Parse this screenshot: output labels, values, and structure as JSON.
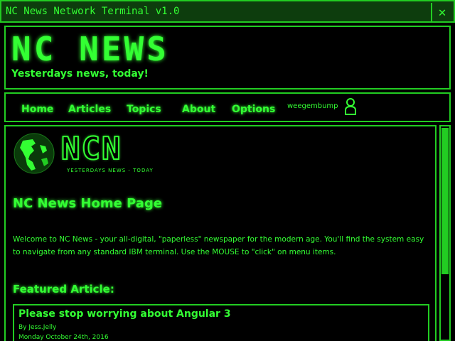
{
  "window": {
    "title": "NC News Network Terminal v1.0",
    "close_label": "✕"
  },
  "header": {
    "logo": "NC NEWS",
    "tagline": "Yesterdays news, today!"
  },
  "nav": {
    "items": [
      "Home",
      "Articles",
      "Topics",
      "About",
      "Options"
    ],
    "username": "weegembump"
  },
  "content": {
    "ncn_logo": "NCN",
    "ncn_sub": "YESTERDAYS NEWS - TODAY",
    "page_title": "NC News Home Page",
    "welcome": "Welcome to NC News - your all-digital, \"paperless\" newspaper for the modern age. You'll find the system easy to navigate from any standard IBM terminal. Use the MOUSE to \"click\" on menu items.",
    "featured_label": "Featured Article:",
    "featured": {
      "title": "Please stop worrying about Angular 3",
      "author": "By Jess.Jelly",
      "date": "Monday October 24th, 2016"
    }
  },
  "colors": {
    "accent": "#33ff33",
    "border": "#22cc22",
    "titlebar_bg": "#0d3d0d",
    "background": "#000000"
  },
  "icons": {
    "close": "close-icon",
    "user": "user-icon",
    "globe": "globe-icon"
  }
}
